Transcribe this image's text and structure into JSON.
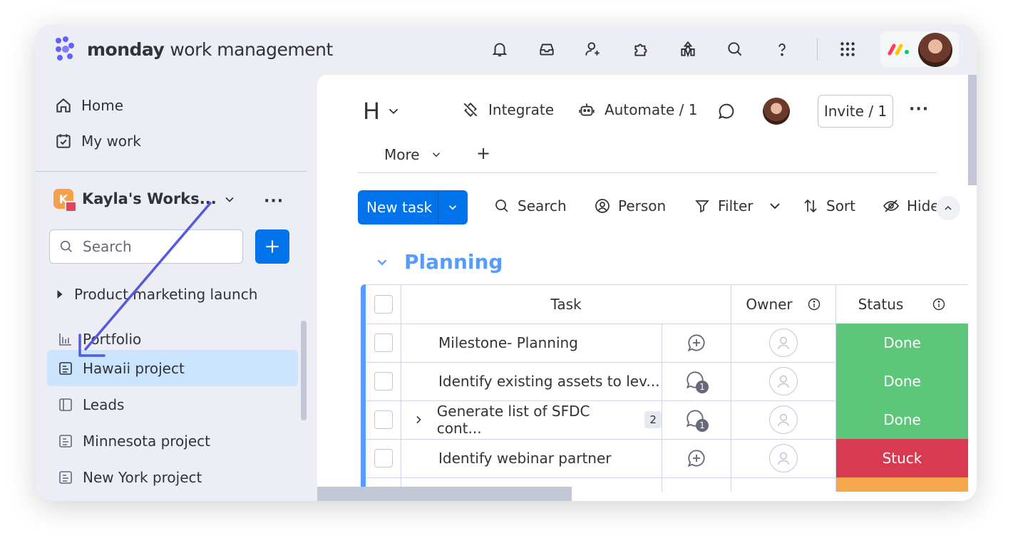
{
  "app": {
    "brand": "monday",
    "product": "work management"
  },
  "topbar": {
    "icons": [
      "bell-icon",
      "inbox-icon",
      "invite-members-icon",
      "apps-icon",
      "marketplace-icon",
      "search-icon",
      "help-icon",
      "app-switcher-icon"
    ]
  },
  "sidebar": {
    "home": "Home",
    "my_work": "My work",
    "workspace": {
      "badge": "K",
      "name": "Kayla's Works..."
    },
    "search_placeholder": "Search",
    "folder": "Product marketing launch",
    "items": [
      {
        "label": "Portfolio",
        "icon": "portfolio-icon",
        "active": false
      },
      {
        "label": "Hawaii project",
        "icon": "board-icon",
        "active": true
      },
      {
        "label": "Leads",
        "icon": "dashboard-icon",
        "active": false
      },
      {
        "label": "Minnesota project",
        "icon": "board-icon",
        "active": false
      },
      {
        "label": "New York project",
        "icon": "board-icon",
        "active": false
      }
    ]
  },
  "board": {
    "title": "H",
    "integrate": "Integrate",
    "automate": "Automate / 1",
    "invite": "Invite / 1",
    "tab_more": "More",
    "tab_add": "+",
    "toolbar": {
      "new_task": "New task",
      "search": "Search",
      "person": "Person",
      "filter": "Filter",
      "sort": "Sort",
      "hide": "Hide"
    },
    "group": {
      "title": "Planning",
      "columns": {
        "task": "Task",
        "owner": "Owner",
        "status": "Status"
      },
      "rows": [
        {
          "task": "Milestone- Planning",
          "subitems": "",
          "updates": "",
          "status": "Done",
          "status_color": "#5ec67a"
        },
        {
          "task": "Identify existing assets to lev...",
          "subitems": "",
          "updates": "1",
          "status": "Done",
          "status_color": "#5ec67a"
        },
        {
          "task": "Generate list of SFDC cont...",
          "subitems": "2",
          "updates": "1",
          "status": "Done",
          "status_color": "#5ec67a"
        },
        {
          "task": "Identify webinar partner",
          "subitems": "",
          "updates": "",
          "status": "Stuck",
          "status_color": "#d83a52"
        }
      ]
    }
  },
  "colors": {
    "primary": "#0073ea",
    "group": "#579bfc",
    "done": "#5ec67a",
    "stuck": "#d83a52",
    "working": "#f5a84b",
    "annotation_arrow": "#5559df"
  }
}
